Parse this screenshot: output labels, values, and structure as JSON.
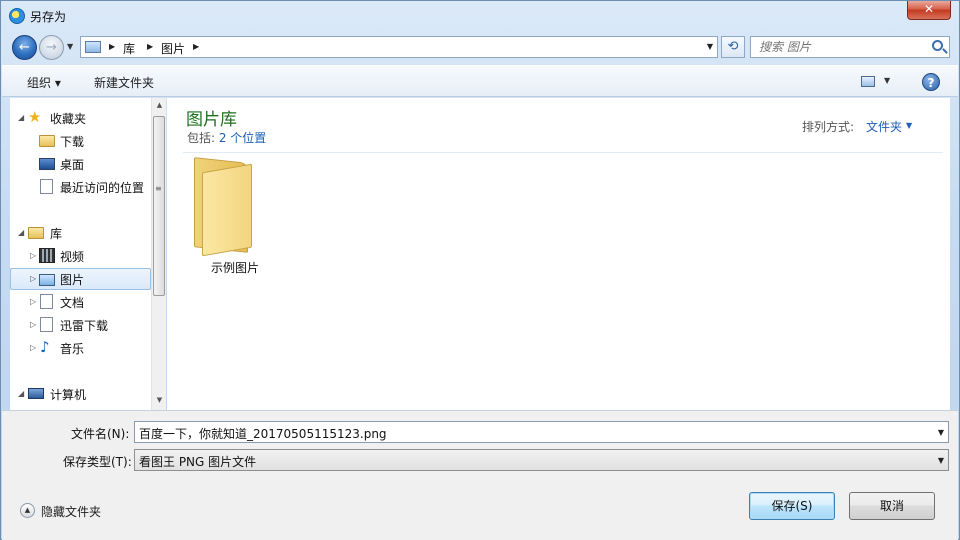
{
  "window": {
    "title": "另存为",
    "close_label": "✕"
  },
  "address_bar": {
    "crumbs": [
      "库",
      "图片"
    ],
    "search_placeholder": "搜索 图片"
  },
  "toolbar": {
    "organize_label": "组织 ▾",
    "new_folder_label": "新建文件夹",
    "help_label": "?"
  },
  "nav_tree": {
    "favorites": {
      "label": "收藏夹",
      "items": [
        "下载",
        "桌面",
        "最近访问的位置"
      ]
    },
    "libraries": {
      "label": "库",
      "items": [
        "视频",
        "图片",
        "文档",
        "迅雷下载",
        "音乐"
      ],
      "selected": "图片"
    },
    "computer": {
      "label": "计算机"
    }
  },
  "main": {
    "title": "图片库",
    "subtitle_prefix": "包括: ",
    "subtitle_link": "2 个位置",
    "sort_label": "排列方式:",
    "sort_value": "文件夹",
    "items": [
      {
        "name": "示例图片",
        "icon": "folder-icon"
      }
    ]
  },
  "form": {
    "filename_label": "文件名(N):",
    "filename_value": "百度一下，你就知道_20170505115123.png",
    "filetype_label": "保存类型(T):",
    "filetype_value": "看图王 PNG 图片文件",
    "hide_folders_label": "隐藏文件夹",
    "save_label": "保存(S)",
    "cancel_label": "取消"
  },
  "colors": {
    "library_title": "#1e6f1e",
    "link": "#1d5fb6",
    "close_button": "#c23a20"
  }
}
